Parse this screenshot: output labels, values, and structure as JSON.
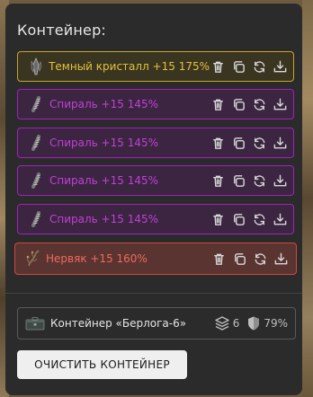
{
  "panel": {
    "title": "Контейнер:"
  },
  "items": [
    {
      "label": "Темный кристалл +15 175%",
      "rarity": "gold",
      "color": "#c9a52a",
      "icon": "crystal-icon"
    },
    {
      "label": "Спираль +15 145%",
      "rarity": "purple",
      "color": "#a51fbf",
      "icon": "spiral-icon"
    },
    {
      "label": "Спираль +15 145%",
      "rarity": "purple",
      "color": "#a51fbf",
      "icon": "spiral-icon"
    },
    {
      "label": "Спираль +15 145%",
      "rarity": "purple",
      "color": "#a51fbf",
      "icon": "spiral-icon"
    },
    {
      "label": "Спираль +15 145%",
      "rarity": "purple",
      "color": "#a51fbf",
      "icon": "spiral-icon"
    },
    {
      "label": "Нервяк +15 160%",
      "rarity": "red",
      "color": "#d2473f",
      "icon": "nervyak-icon"
    }
  ],
  "item_actions": [
    "trash-icon",
    "copy-icon",
    "swap-icon",
    "download-icon"
  ],
  "container": {
    "name": "Контейнер «Берлога-6»",
    "slots": "6",
    "protection": "79%",
    "icon": "container-case-icon"
  },
  "buttons": {
    "clear": "ОЧИСТИТЬ КОНТЕЙНЕР"
  }
}
